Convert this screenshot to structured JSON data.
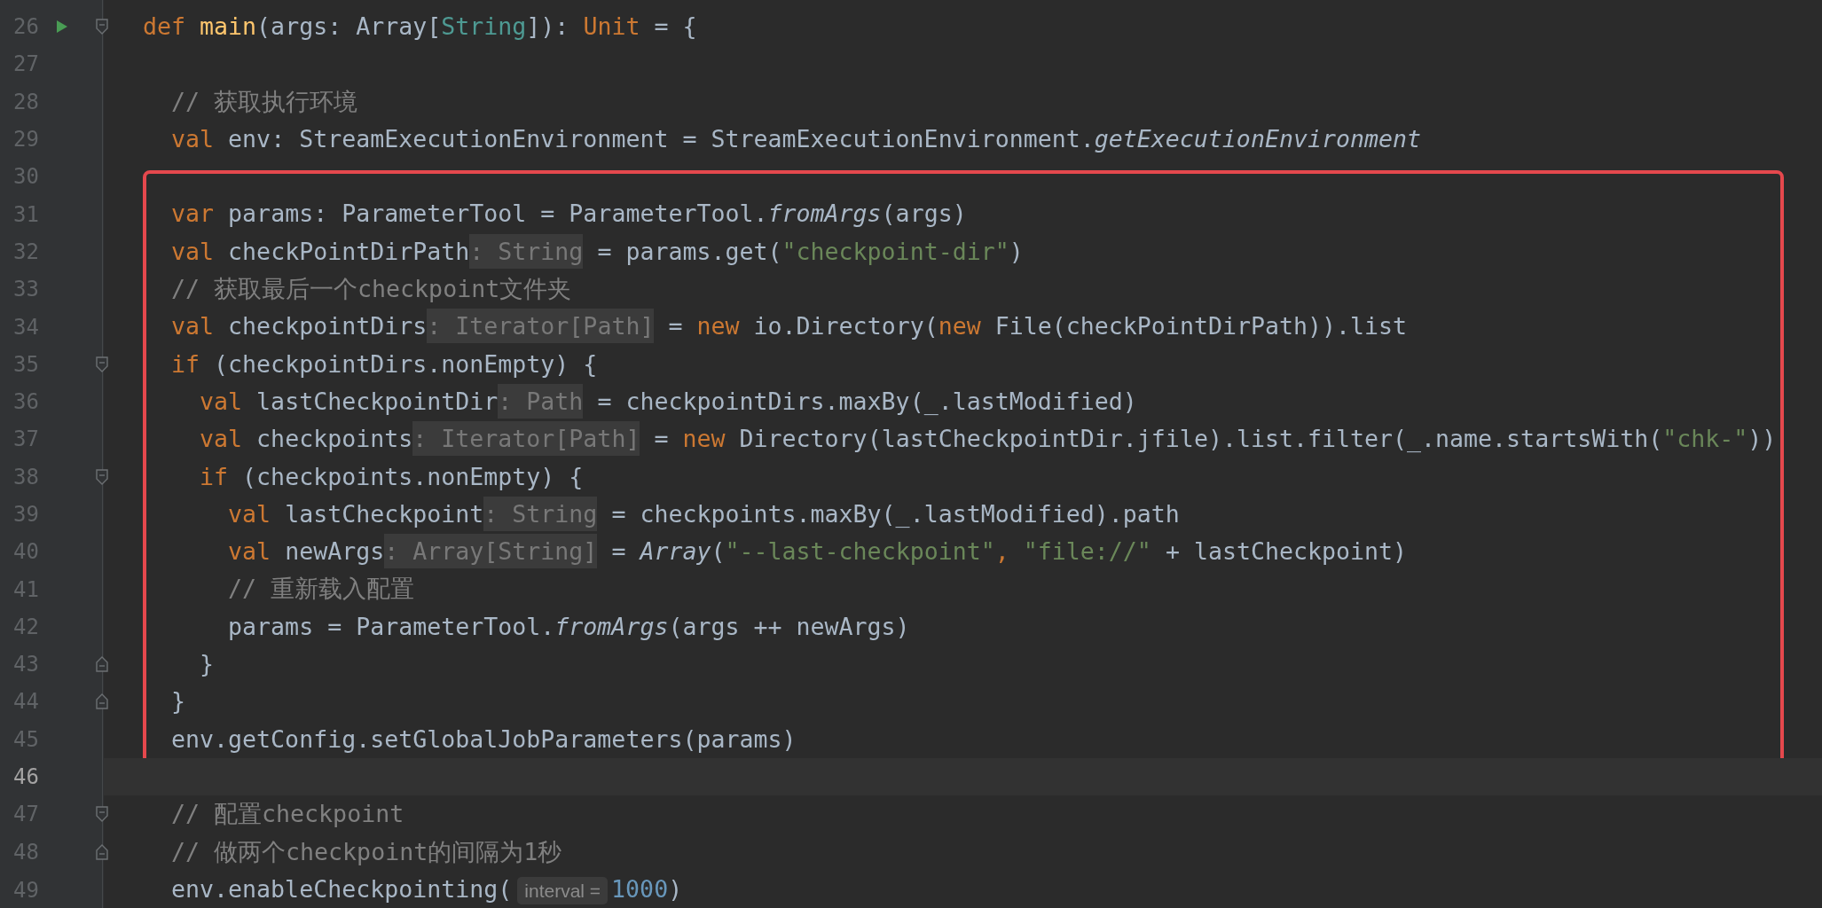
{
  "lines_before": [
    {
      "number": "26",
      "run": true,
      "current": false,
      "fold": {
        "kind": "start"
      },
      "tokens": [
        {
          "kind": "keyword",
          "text": "def "
        },
        {
          "kind": "function",
          "text": "main"
        },
        {
          "kind": "plain",
          "text": "(args: Array["
        },
        {
          "kind": "type",
          "text": "String"
        },
        {
          "kind": "plain",
          "text": "]): "
        },
        {
          "kind": "keyword",
          "text": "Unit"
        },
        {
          "kind": "plain",
          "text": " = {"
        }
      ]
    },
    {
      "number": "27",
      "run": false,
      "current": false
    },
    {
      "number": "28",
      "run": false,
      "current": false,
      "tokens": [
        {
          "kind": "comment",
          "text": "  // 获取执行环境"
        }
      ]
    },
    {
      "number": "29",
      "run": false,
      "current": false,
      "tokens": [
        {
          "kind": "keyword",
          "text": "  val "
        },
        {
          "kind": "plain",
          "text": "env: StreamExecutionEnvironment = StreamExecutionEnvironment."
        },
        {
          "kind": "italic",
          "text": "getExecutionEnvironment"
        }
      ]
    },
    {
      "number": "30",
      "run": false,
      "current": false
    }
  ],
  "highlighted_block": {
    "lines": [
      {
        "number": "31",
        "run": false,
        "current": false,
        "tokens": [
          {
            "kind": "keyword",
            "text": "  var "
          },
          {
            "kind": "plain",
            "text": "params: ParameterTool = ParameterTool."
          },
          {
            "kind": "italic",
            "text": "fromArgs"
          },
          {
            "kind": "plain",
            "text": "(args)"
          }
        ]
      },
      {
        "number": "32",
        "run": false,
        "current": false,
        "tokens": [
          {
            "kind": "keyword",
            "text": "  val "
          },
          {
            "kind": "plain",
            "text": "checkPointDirPath"
          },
          {
            "kind": "hint",
            "text": ": String"
          },
          {
            "kind": "plain",
            "text": " = params.get("
          },
          {
            "kind": "string",
            "text": "\"checkpoint-dir\""
          },
          {
            "kind": "plain",
            "text": ")"
          }
        ]
      },
      {
        "number": "33",
        "run": false,
        "current": false,
        "tokens": [
          {
            "kind": "comment",
            "text": "  // 获取最后一个checkpoint文件夹"
          }
        ]
      },
      {
        "number": "34",
        "run": false,
        "current": false,
        "tokens": [
          {
            "kind": "keyword",
            "text": "  val "
          },
          {
            "kind": "plain",
            "text": "checkpointDirs"
          },
          {
            "kind": "hint",
            "text": ": Iterator[Path]"
          },
          {
            "kind": "plain",
            "text": " = "
          },
          {
            "kind": "keyword",
            "text": "new "
          },
          {
            "kind": "plain",
            "text": "io.Directory("
          },
          {
            "kind": "keyword",
            "text": "new "
          },
          {
            "kind": "plain",
            "text": "File(checkPointDirPath)).list"
          }
        ]
      },
      {
        "number": "35",
        "run": false,
        "current": false,
        "fold": {
          "kind": "start"
        },
        "tokens": [
          {
            "kind": "keyword",
            "text": "  if "
          },
          {
            "kind": "plain",
            "text": "(checkpointDirs.nonEmpty) {"
          }
        ]
      },
      {
        "number": "36",
        "run": false,
        "current": false,
        "tokens": [
          {
            "kind": "keyword",
            "text": "    val "
          },
          {
            "kind": "plain",
            "text": "lastCheckpointDir"
          },
          {
            "kind": "hint",
            "text": ": Path"
          },
          {
            "kind": "plain",
            "text": " = checkpointDirs.maxBy(_.lastModified)"
          }
        ]
      },
      {
        "number": "37",
        "run": false,
        "current": false,
        "tokens": [
          {
            "kind": "keyword",
            "text": "    val "
          },
          {
            "kind": "plain",
            "text": "checkpoints"
          },
          {
            "kind": "hint",
            "text": ": Iterator[Path]"
          },
          {
            "kind": "plain",
            "text": " = "
          },
          {
            "kind": "keyword",
            "text": "new "
          },
          {
            "kind": "plain",
            "text": "Directory(lastCheckpointDir.jfile).list.filter(_.name.startsWith("
          },
          {
            "kind": "string",
            "text": "\"chk-\""
          },
          {
            "kind": "plain",
            "text": "))"
          }
        ]
      },
      {
        "number": "38",
        "run": false,
        "current": false,
        "fold": {
          "kind": "start"
        },
        "tokens": [
          {
            "kind": "keyword",
            "text": "    if "
          },
          {
            "kind": "plain",
            "text": "(checkpoints.nonEmpty) {"
          }
        ]
      },
      {
        "number": "39",
        "run": false,
        "current": false,
        "tokens": [
          {
            "kind": "keyword",
            "text": "      val "
          },
          {
            "kind": "plain",
            "text": "lastCheckpoint"
          },
          {
            "kind": "hint",
            "text": ": String"
          },
          {
            "kind": "plain",
            "text": " = checkpoints.maxBy(_.lastModified).path"
          }
        ]
      },
      {
        "number": "40",
        "run": false,
        "current": false,
        "tokens": [
          {
            "kind": "keyword",
            "text": "      val "
          },
          {
            "kind": "plain",
            "text": "newArgs"
          },
          {
            "kind": "hint",
            "text": ": Array[String]"
          },
          {
            "kind": "plain",
            "text": " = "
          },
          {
            "kind": "italic",
            "text": "Array"
          },
          {
            "kind": "plain",
            "text": "("
          },
          {
            "kind": "string",
            "text": "\"--last-checkpoint\""
          },
          {
            "kind": "keyword",
            "text": ", "
          },
          {
            "kind": "string",
            "text": "\"file://\""
          },
          {
            "kind": "plain",
            "text": " + lastCheckpoint)"
          }
        ]
      },
      {
        "number": "41",
        "run": false,
        "current": false,
        "tokens": [
          {
            "kind": "comment",
            "text": "      // 重新载入配置"
          }
        ]
      },
      {
        "number": "42",
        "run": false,
        "current": false,
        "tokens": [
          {
            "kind": "plain",
            "text": "      params = ParameterTool."
          },
          {
            "kind": "italic",
            "text": "fromArgs"
          },
          {
            "kind": "plain",
            "text": "(args ++ newArgs)"
          }
        ]
      },
      {
        "number": "43",
        "run": false,
        "current": false,
        "fold": {
          "kind": "end"
        },
        "tokens": [
          {
            "kind": "plain",
            "text": "    }"
          }
        ]
      },
      {
        "number": "44",
        "run": false,
        "current": false,
        "fold": {
          "kind": "end"
        },
        "tokens": [
          {
            "kind": "plain",
            "text": "  }"
          }
        ]
      },
      {
        "number": "45",
        "run": false,
        "current": false,
        "tokens": [
          {
            "kind": "plain",
            "text": "  env.getConfig.setGlobalJobParameters(params)"
          }
        ]
      }
    ]
  },
  "lines_after": [
    {
      "number": "46",
      "run": false,
      "current": true
    },
    {
      "number": "47",
      "run": false,
      "current": false,
      "fold": {
        "kind": "start"
      },
      "tokens": [
        {
          "kind": "comment",
          "text": "  // 配置checkpoint"
        }
      ]
    },
    {
      "number": "48",
      "run": false,
      "current": false,
      "fold": {
        "kind": "end"
      },
      "tokens": [
        {
          "kind": "comment",
          "text": "  // 做两个checkpoint的间隔为1秒"
        }
      ]
    },
    {
      "number": "49",
      "run": false,
      "current": false,
      "tokens": [
        {
          "kind": "plain",
          "text": "  env.enableCheckpointing("
        },
        {
          "kind": "param",
          "text": "interval ="
        },
        {
          "kind": "number",
          "text": "1000"
        },
        {
          "kind": "plain",
          "text": ")"
        }
      ]
    }
  ]
}
